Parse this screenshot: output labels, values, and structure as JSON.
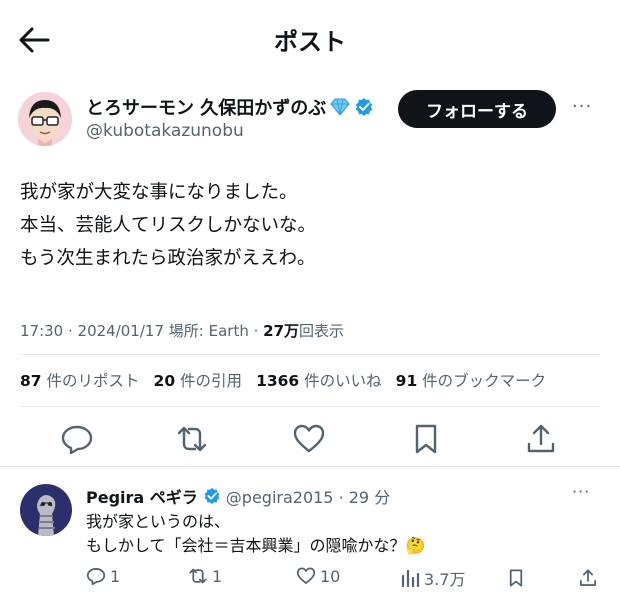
{
  "header": {
    "title": "ポスト"
  },
  "author": {
    "name": "とろサーモン 久保田かずのぶ",
    "handle": "@kubotakazunobu",
    "follow_label": "フォローする",
    "more": "···"
  },
  "tweet": {
    "lines": [
      "我が家が大変な事になりました。",
      "本当、芸能人てリスクしかないな。",
      "もう次生まれたら政治家がええわ。"
    ],
    "time": "17:30 · 2024/01/17",
    "location": "場所: Earth ·",
    "views_count": "27",
    "views_unit": "万",
    "views_label": "回表示"
  },
  "stats": [
    {
      "count": "87",
      "label": "件のリポスト"
    },
    {
      "count": "20",
      "label": "件の引用"
    },
    {
      "count": "1366",
      "label": "件のいいね"
    },
    {
      "count": "91",
      "label": "件のブックマーク"
    }
  ],
  "actions": [
    "reply-icon",
    "retweet-icon",
    "like-icon",
    "bookmark-icon",
    "share-icon"
  ],
  "reply": {
    "name": "Pegira ペギラ",
    "handle": "@pegira2015 · 29 分",
    "more": "···",
    "lines": [
      "我が家というのは、",
      "もしかして「会社＝吉本興業」の隠喩かな？"
    ],
    "emoji": "🤔",
    "replies": "1",
    "retweets": "1",
    "likes": "10",
    "views": "3.7万"
  },
  "colors": {
    "verified": "#1d9bf0",
    "muted": "#536471",
    "text": "#0f1419"
  }
}
